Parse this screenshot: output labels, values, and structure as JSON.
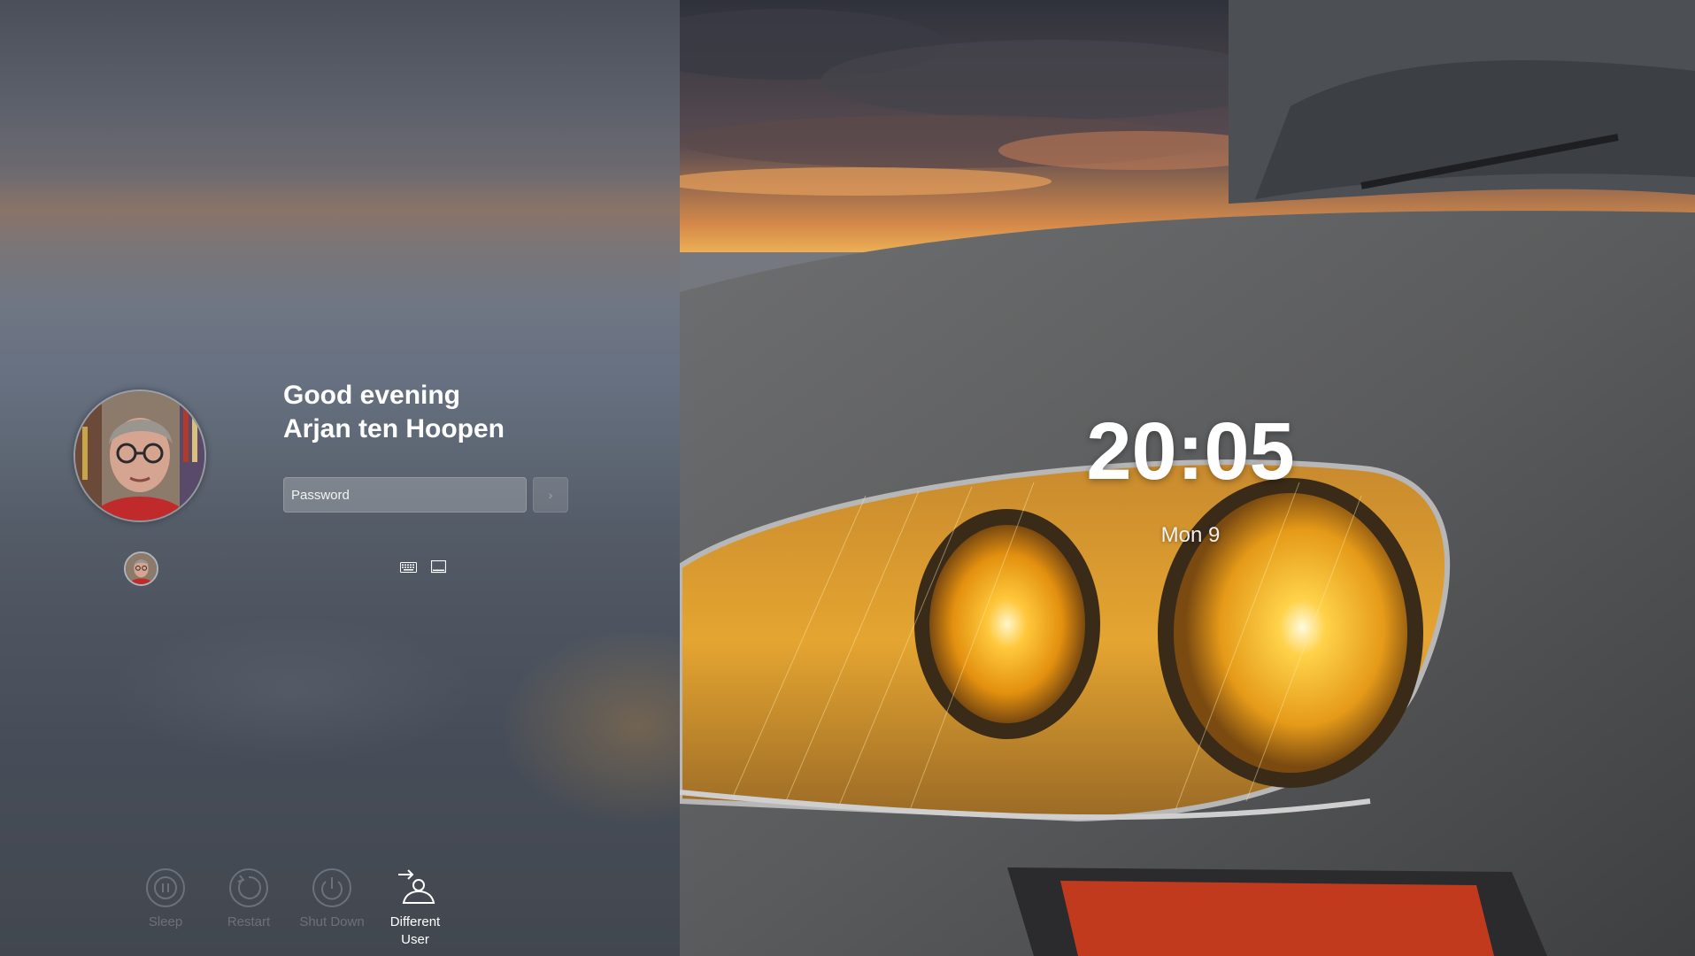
{
  "login": {
    "greeting_line1": "Good evening",
    "greeting_line2": "Arjan ten Hoopen",
    "password_placeholder": "Password",
    "submit_glyph": "›",
    "avatar_icon": "user-photo-avatar",
    "switch_user_icon": "user-photo-avatar-small",
    "keyboard_icon": "keyboard-icon",
    "virtual_keyboard_icon": "virtual-keyboard-icon"
  },
  "actions": [
    {
      "label": "Sleep",
      "icon": "sleep-icon"
    },
    {
      "label": "Restart",
      "icon": "restart-icon"
    },
    {
      "label": "Shut Down",
      "icon": "shutdown-icon"
    },
    {
      "label": "Different User",
      "icon": "different-user-icon"
    }
  ],
  "clock": {
    "time": "20:05",
    "date": "Mon 9"
  },
  "colors": {
    "text": "#ffffff",
    "dim_text": "#6b727d",
    "headlight": "#f4a51c"
  }
}
